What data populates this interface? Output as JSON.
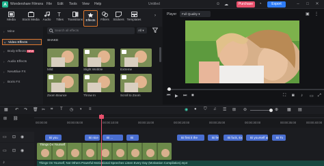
{
  "app": {
    "logo": "filmora-logo",
    "name": "Wondershare Filmora",
    "menu": [
      "File",
      "Edit",
      "Tools",
      "View",
      "Help"
    ],
    "title": "Untitled",
    "purchase_label": "Purchase",
    "export_label": "Export",
    "window_buttons": [
      "–",
      "□",
      "✕"
    ]
  },
  "media_toolbar": {
    "tools": [
      {
        "label": "Media",
        "icon": "media-icon"
      },
      {
        "label": "Stock Media",
        "icon": "stock-media-icon"
      },
      {
        "label": "Audio",
        "icon": "music-icon"
      },
      {
        "label": "Titles",
        "icon": "titles-icon"
      },
      {
        "label": "Transitions",
        "icon": "transitions-icon"
      },
      {
        "label": "Effects",
        "icon": "effects-icon",
        "active": true
      },
      {
        "label": "Filters",
        "icon": "filters-icon"
      },
      {
        "label": "Stickers",
        "icon": "stickers-icon"
      },
      {
        "label": "Templates",
        "icon": "templates-icon"
      }
    ]
  },
  "sidebar": {
    "items": [
      {
        "label": "Mine"
      },
      {
        "label": "Video Effects",
        "active": true
      },
      {
        "label": "Body Effects",
        "badge": "NEW"
      },
      {
        "label": "Audio Effects"
      },
      {
        "label": "NewBlue FX"
      },
      {
        "label": "Boris FX"
      }
    ]
  },
  "browser": {
    "search_placeholder": "Search all effects",
    "filter_value": "All",
    "section": "SHAKE",
    "effects": [
      {
        "label": "Mild",
        "ai": false
      },
      {
        "label": "Slight Wobble",
        "ai": true
      },
      {
        "label": "Extreme",
        "ai": true
      },
      {
        "label": "Zoom Bounce",
        "ai": true
      },
      {
        "label": "Throw In",
        "ai": true
      },
      {
        "label": "Scroll to Zoom",
        "ai": true
      }
    ]
  },
  "player": {
    "label": "Player",
    "quality": "Full Quality"
  },
  "timeline": {
    "ruler": [
      "00:00:00",
      "00:00:05:00",
      "00:00:10:00",
      "00:00:15:00",
      "00:00:20:00",
      "00:00:25:00",
      "00:00:30:00",
      "00:00:35:00",
      "00:00:40:00"
    ],
    "text_clips": [
      "Bi you",
      "Bi nice",
      "Bi ...",
      "Bi",
      "Bi first it the",
      "Bi few",
      "Bi fuck, Exerci...",
      "Bi yourself ar th...",
      "Bi To"
    ],
    "video_clip_title": "Things On Yourself",
    "audio_label": "Things On Yourself, Not Others Powerful Motivational Speeches Listen Every Day (Motivation Compilation).mp4"
  },
  "colors": {
    "accent_orange": "#e27a2f",
    "purchase": "#e8506c",
    "export": "#2e7cf6",
    "playhead": "#e8506c",
    "text_clip": "#4a6fd1"
  }
}
